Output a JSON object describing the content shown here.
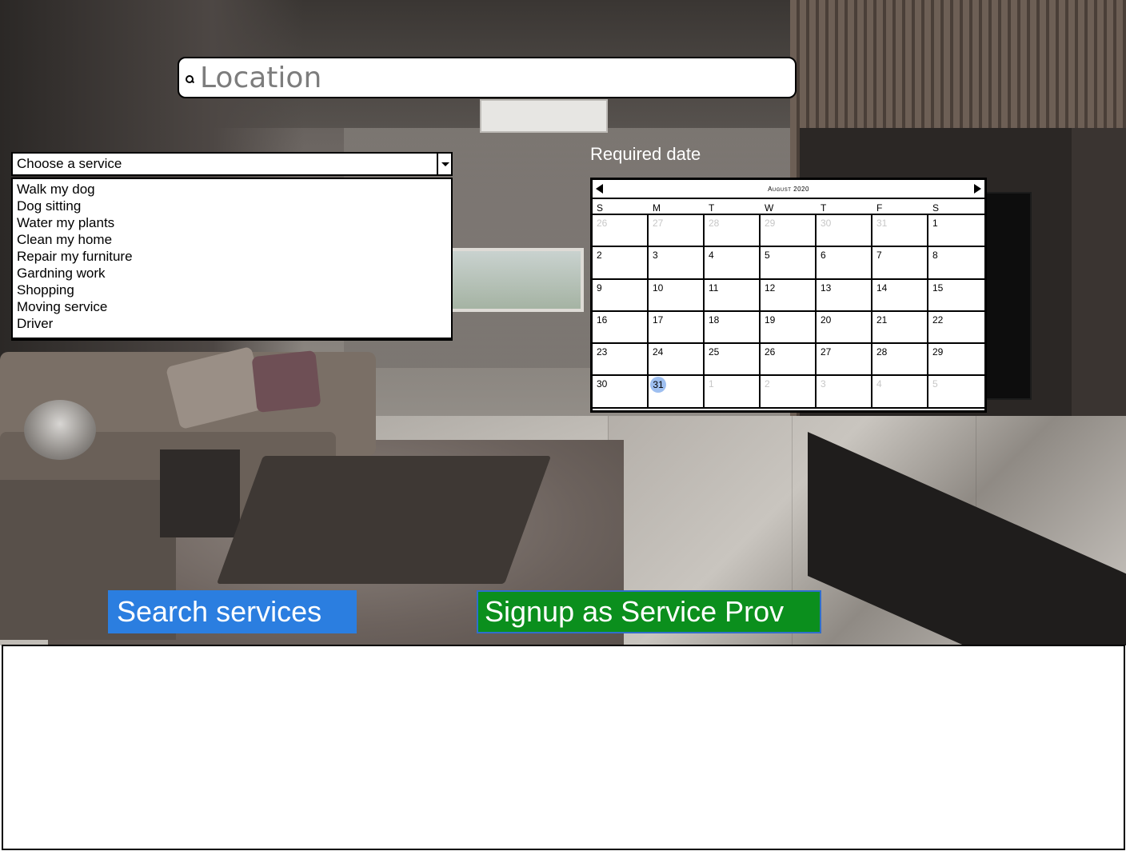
{
  "location": {
    "placeholder": "Location",
    "icon": "search-icon"
  },
  "service": {
    "selected": "Choose a service",
    "options": [
      "Walk my dog",
      "Dog sitting",
      "Water my plants",
      "Clean my home",
      "Repair my furniture",
      "Gardning work",
      "Shopping",
      "Moving service",
      "Driver"
    ]
  },
  "date": {
    "label": "Required date",
    "month": "August 2020",
    "weekdays": [
      "S",
      "M",
      "T",
      "W",
      "T",
      "F",
      "S"
    ],
    "days": [
      [
        "26",
        "27",
        "28",
        "29",
        "30",
        "31",
        "1"
      ],
      [
        "2",
        "3",
        "4",
        "5",
        "6",
        "7",
        "8"
      ],
      [
        "9",
        "10",
        "11",
        "12",
        "13",
        "14",
        "15"
      ],
      [
        "16",
        "17",
        "18",
        "19",
        "20",
        "21",
        "22"
      ],
      [
        "23",
        "24",
        "25",
        "26",
        "27",
        "28",
        "29"
      ],
      [
        "30",
        "31",
        "1",
        "2",
        "3",
        "4",
        "5"
      ]
    ],
    "selected_day": "31"
  },
  "buttons": {
    "search": "Search services",
    "signup": "Signup as Service Prov"
  },
  "colors": {
    "search_button": "#2b7ee0",
    "signup_button": "#0b8f1d",
    "selected_day": "#9ebff0"
  }
}
